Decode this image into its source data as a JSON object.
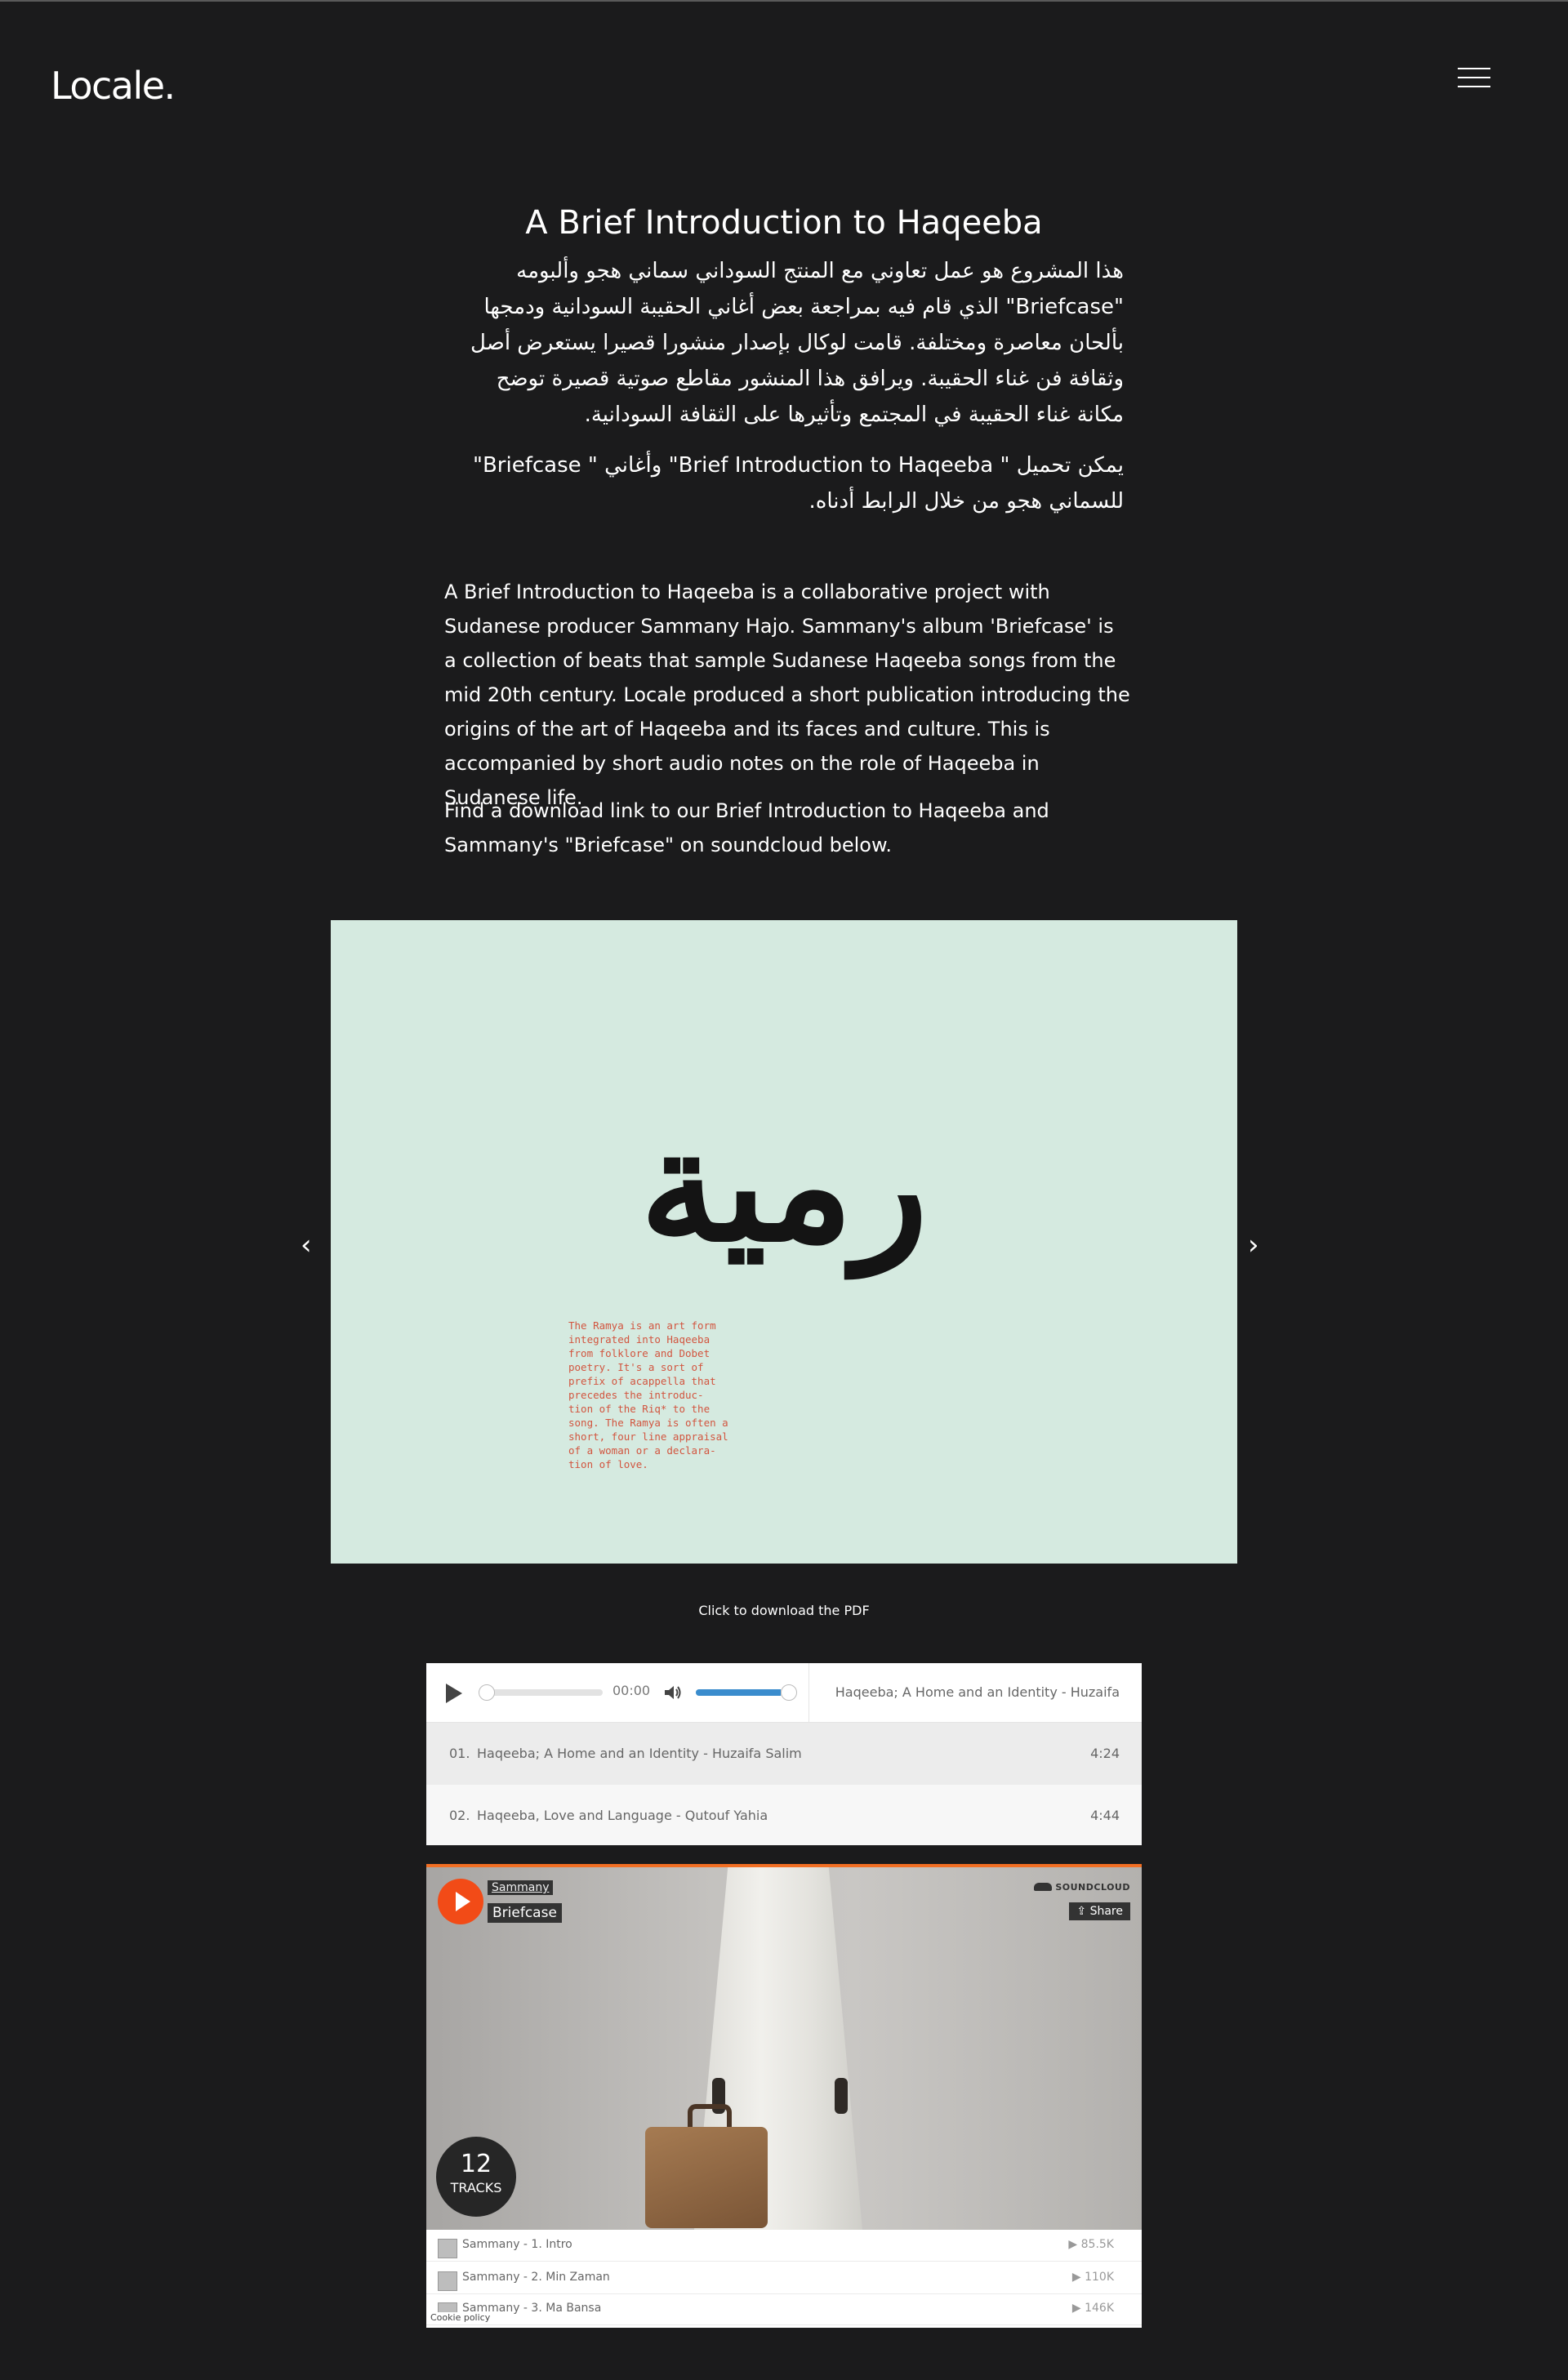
{
  "header": {
    "logo": "Locale.",
    "menu_icon": "hamburger-menu-icon"
  },
  "main": {
    "title": "A Brief Introduction to Haqeeba",
    "arabic_paragraph_1": "هذا المشروع هو عمل تعاوني مع المنتج السوداني سماني هجو وألبومه \"Briefcase\" الذي قام فيه بمراجعة بعض أغاني الحقيبة السودانية ودمجها بألحان معاصرة ومختلفة. قامت لوكال بإصدار منشورا قصيرا يستعرض أصل وثقافة فن غناء الحقيبة. ويرافق هذا المنشور مقاطع صوتية قصيرة توضح مكانة غناء الحقيبة في المجتمع وتأثيرها على الثقافة السودانية.",
    "arabic_paragraph_2": "يمكن تحميل \" Brief Introduction to Haqeeba\" وأغاني \" Briefcase\" للسماني هجو من خلال الرابط أدناه.",
    "english_paragraph_1": "A Brief Introduction to Haqeeba is a collaborative project with Sudanese producer Sammany Hajo. Sammany's album 'Briefcase' is a collection of beats that sample Sudanese Haqeeba songs from the mid 20th century. Locale produced a short publication introducing the origins of the art of Haqeeba and its faces and culture. This is accompanied by short audio notes on the role of Haqeeba in Sudanese life.",
    "english_paragraph_2": "Find a download link to our Brief Introduction to Haqeeba and Sammany's \"Briefcase\" on soundcloud below."
  },
  "slideshow": {
    "calligraphy": "رمية",
    "slide_text": "The Ramya is an art form\nintegrated into Haqeeba\nfrom folklore and Dobet\npoetry. It's a sort of\nprefix of acappella  that\nprecedes the introduc-\ntion of the Riq* to the\nsong. The Ramya is often a\nshort, four line appraisal\nof a woman or a declara-\ntion of love.",
    "background_color": "#d5eae0",
    "prev_arrow": "‹",
    "next_arrow": "›",
    "caption": "Click to download the PDF"
  },
  "audio_player": {
    "current_time": "00:00",
    "volume_level": 0.88,
    "now_playing": "Haqeeba; A Home and an Identity - Huzaifa Salim",
    "tracks": [
      {
        "number": "01.",
        "title": "Haqeeba; A Home and an Identity - Huzaifa Salim",
        "duration": "4:24"
      },
      {
        "number": "02.",
        "title": "Haqeeba, Love and Language - Qutouf Yahia",
        "duration": "4:44"
      }
    ]
  },
  "soundcloud": {
    "user": "Sammany",
    "title": "Briefcase",
    "brand": "SOUNDCLOUD",
    "share_label": "Share",
    "track_count": "12",
    "track_count_label": "TRACKS",
    "accent_color": "#f26f23",
    "tracks": [
      {
        "title": "Sammany - 1. Intro",
        "plays": "▶ 85.5K"
      },
      {
        "title": "Sammany - 2. Min Zaman",
        "plays": "▶ 110K"
      },
      {
        "title": "Sammany - 3. Ma Bansa",
        "plays": "▶ 146K"
      }
    ],
    "cookie_policy": "Cookie policy"
  }
}
